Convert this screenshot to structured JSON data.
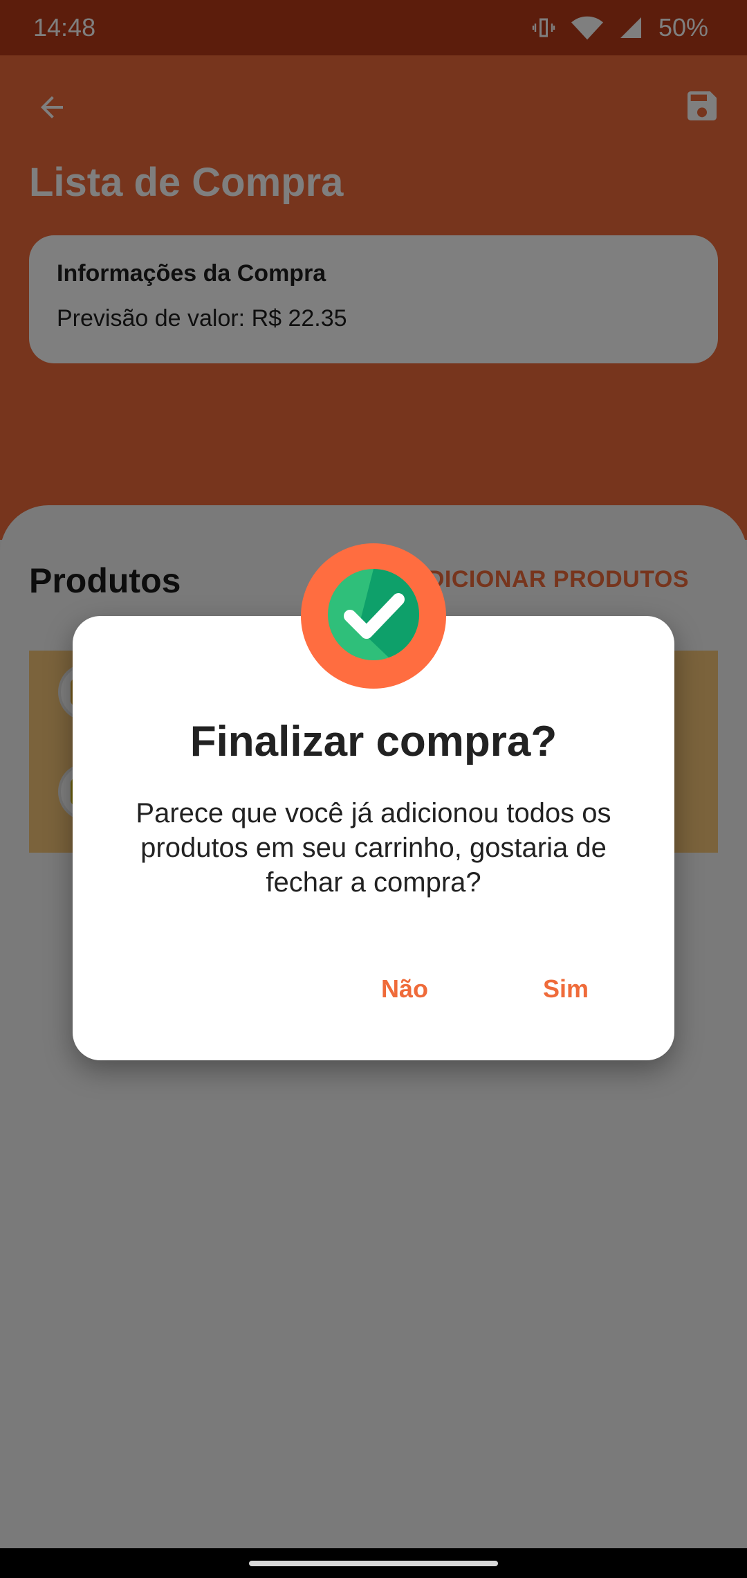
{
  "status_bar": {
    "time": "14:48",
    "battery": "50%",
    "icons": [
      "vibrate-icon",
      "wifi-icon",
      "signal-icon"
    ]
  },
  "app_bar": {
    "title": "Lista de Compra",
    "back_icon": "arrow-back-icon",
    "save_icon": "save-icon"
  },
  "info_card": {
    "title": "Informações da Compra",
    "estimate": "Previsão de valor: R$ 22.35"
  },
  "products": {
    "title": "Produtos",
    "add_button": "ADICIONAR PRODUTOS"
  },
  "dialog": {
    "title": "Finalizar compra?",
    "message": "Parece que você já adicionou todos os produtos em seu carrinho, gostaria de fechar a compra?",
    "no_button": "Não",
    "yes_button": "Sim",
    "icon": "check-circle-icon"
  },
  "colors": {
    "primary": "#ef6b3a",
    "status_bar": "#b93b18",
    "accent_badge": "#ff6d40",
    "success": "#2fbf7a"
  }
}
